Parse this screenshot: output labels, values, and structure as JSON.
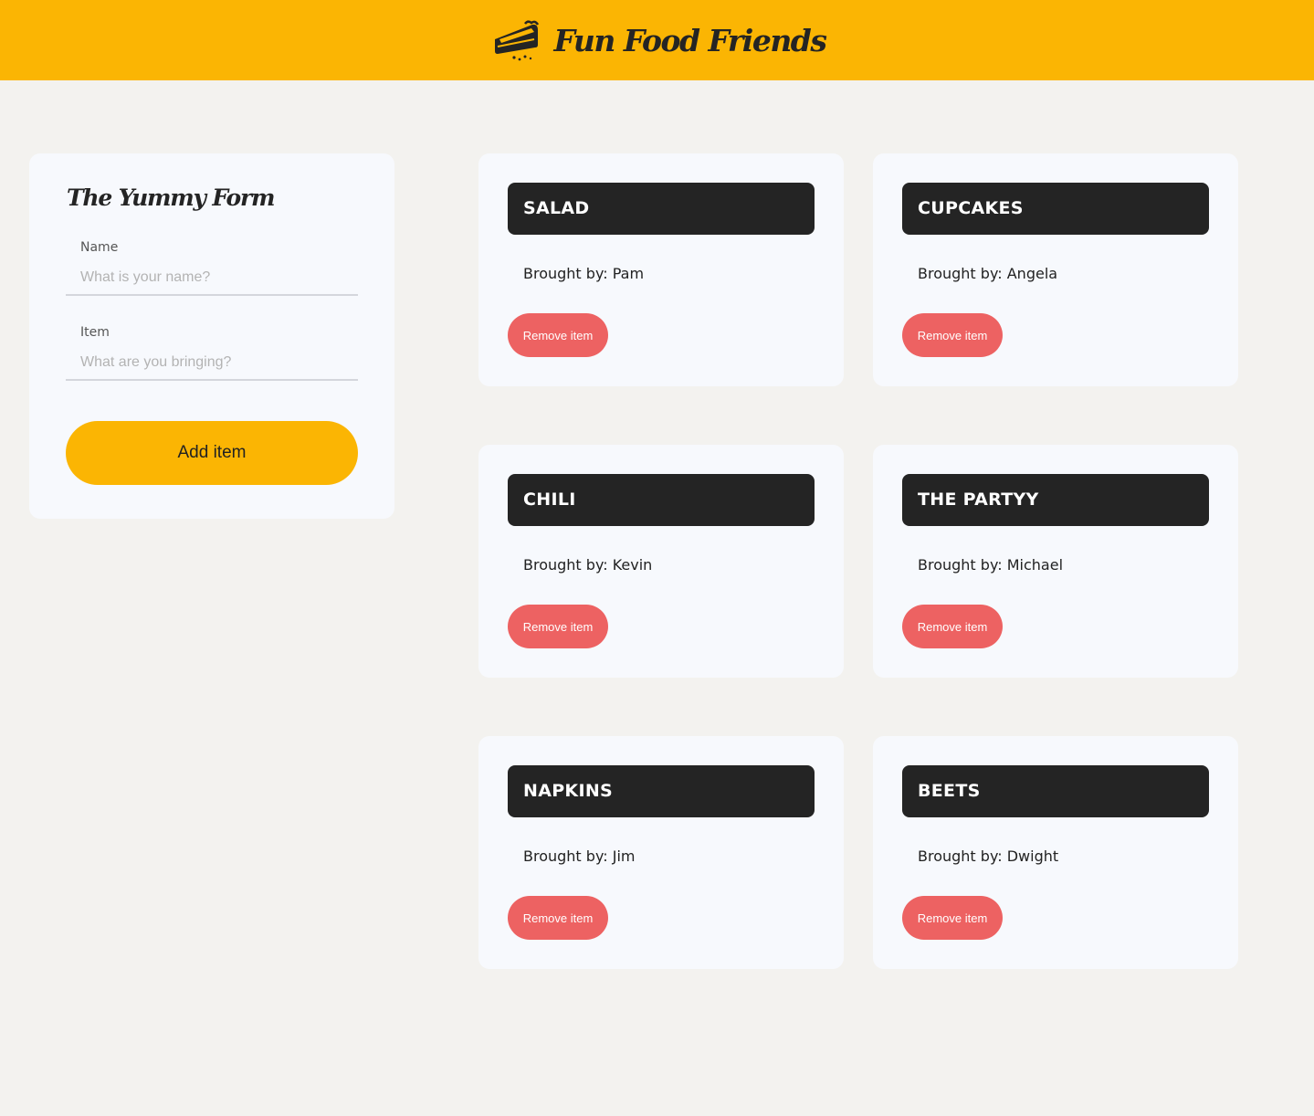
{
  "header": {
    "logo_icon": "pie-slice-icon",
    "title": "Fun Food Friends"
  },
  "form": {
    "title": "The Yummy Form",
    "name_label": "Name",
    "name_value": "",
    "name_placeholder": "What is your name?",
    "item_label": "Item",
    "item_value": "",
    "item_placeholder": "What are you bringing?",
    "submit_label": "Add item"
  },
  "items": [
    {
      "name": "SALAD",
      "brought_by": "Brought by: Pam",
      "remove_label": "Remove item"
    },
    {
      "name": "CUPCAKES",
      "brought_by": "Brought by: Angela",
      "remove_label": "Remove item"
    },
    {
      "name": "CHILI",
      "brought_by": "Brought by: Kevin",
      "remove_label": "Remove item"
    },
    {
      "name": "THE PARTYY",
      "brought_by": "Brought by: Michael",
      "remove_label": "Remove item"
    },
    {
      "name": "NAPKINS",
      "brought_by": "Brought by: Jim",
      "remove_label": "Remove item"
    },
    {
      "name": "BEETS",
      "brought_by": "Brought by: Dwight",
      "remove_label": "Remove item"
    }
  ],
  "colors": {
    "brand_yellow": "#fbb503",
    "page_background": "#f3f2ef",
    "card_background": "#f7f9fd",
    "item_header": "#242424",
    "remove_red": "#ed6262"
  }
}
